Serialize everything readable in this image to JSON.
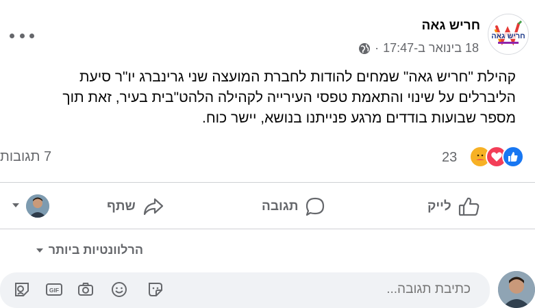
{
  "post": {
    "page_name": "חריש גאה",
    "timestamp": "18 בינואר ב-17:47",
    "separator": "·",
    "logo_text": "חריש גאה",
    "body_lines": [
      "קהילת \"חריש גאה\" שמחים להודות לחברת המועצה שני גרינברג יו\"ר סיעת",
      "הליברלים על שינוי והתאמת טפסי העירייה לקהילה הלהט\"בית בעיר, זאת תוך",
      "מספר שבועות בודדים מרגע פנייתנו בנושא, יישר כוח."
    ]
  },
  "stats": {
    "reaction_count": "23",
    "comments": "7 תגובות",
    "reaction_icons": [
      "like-reaction-icon",
      "love-reaction-icon",
      "care-reaction-icon"
    ],
    "colors": {
      "like": "#1877f2",
      "love": "#f33e58",
      "care": "#f7b125"
    }
  },
  "actions": {
    "like": "לייק",
    "comment": "תגובה",
    "share": "שתף"
  },
  "comments_section": {
    "sort_label": "הרלוונטיות ביותר",
    "input_placeholder": "כתיבת תגובה..."
  }
}
